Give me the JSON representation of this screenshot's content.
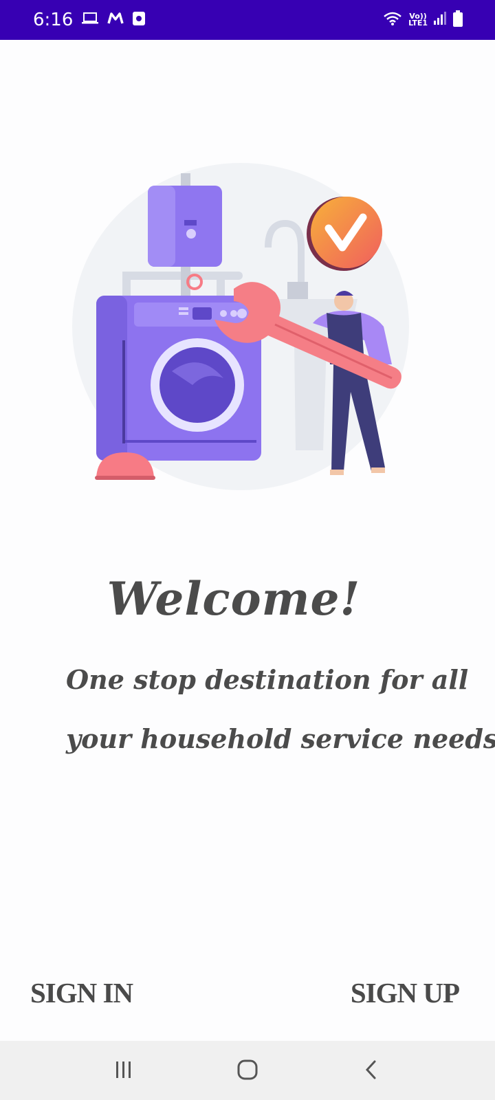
{
  "status_bar": {
    "time": "6:16",
    "network_top": "Vo))",
    "network_bottom": "LTE1",
    "background_color": "#3700b3",
    "icons": [
      "laptop-icon",
      "m-app-icon",
      "media-icon",
      "wifi-icon",
      "signal-icon",
      "battery-icon"
    ]
  },
  "illustration": {
    "description_icons": [
      "water-heater-icon",
      "washing-machine-icon",
      "faucet-icon",
      "check-badge-icon",
      "wrench-icon",
      "plumber-icon",
      "plunger-icon"
    ]
  },
  "welcome": {
    "title": "Welcome!",
    "tagline_line1": "One stop destination for all",
    "tagline_line2": "your household service needs!"
  },
  "auth": {
    "signin_label": "SIGN IN",
    "signup_label": "SIGN UP"
  },
  "nav_bar": {
    "icons": [
      "recent-apps-icon",
      "home-icon",
      "back-icon"
    ]
  },
  "colors": {
    "text": "#4b4b4b",
    "accent_purple": "#7b68ee",
    "accent_pink": "#f77b85",
    "accent_orange": "#f7933a"
  }
}
